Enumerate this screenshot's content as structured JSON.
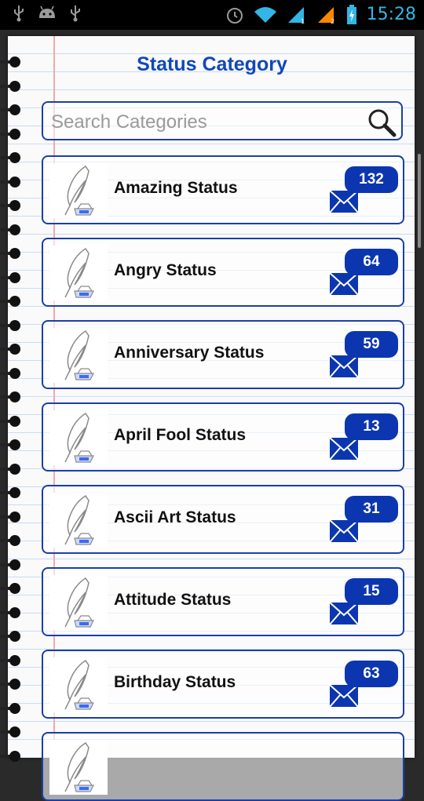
{
  "status_bar": {
    "time": "15:28",
    "left_icons": [
      "usb-icon",
      "android-debug-icon",
      "usb-icon"
    ],
    "right_icons": [
      "alarm-icon",
      "wifi-icon",
      "signal-sim1-icon",
      "signal-sim2-icon",
      "battery-charging-icon"
    ]
  },
  "header": {
    "title": "Status Category"
  },
  "search": {
    "placeholder": "Search Categories"
  },
  "categories": [
    {
      "name": "Amazing Status",
      "count": "132"
    },
    {
      "name": "Angry Status",
      "count": "64"
    },
    {
      "name": "Anniversary Status",
      "count": "59"
    },
    {
      "name": "April Fool Status",
      "count": "13"
    },
    {
      "name": "Ascii Art Status",
      "count": "31"
    },
    {
      "name": "Attitude Status",
      "count": "15"
    },
    {
      "name": "Birthday Status",
      "count": "63"
    }
  ],
  "colors": {
    "accent": "#1048b8",
    "border": "#1b3fa8",
    "badge": "#0c36b0",
    "statusbar_icons": "#33b5e5"
  }
}
